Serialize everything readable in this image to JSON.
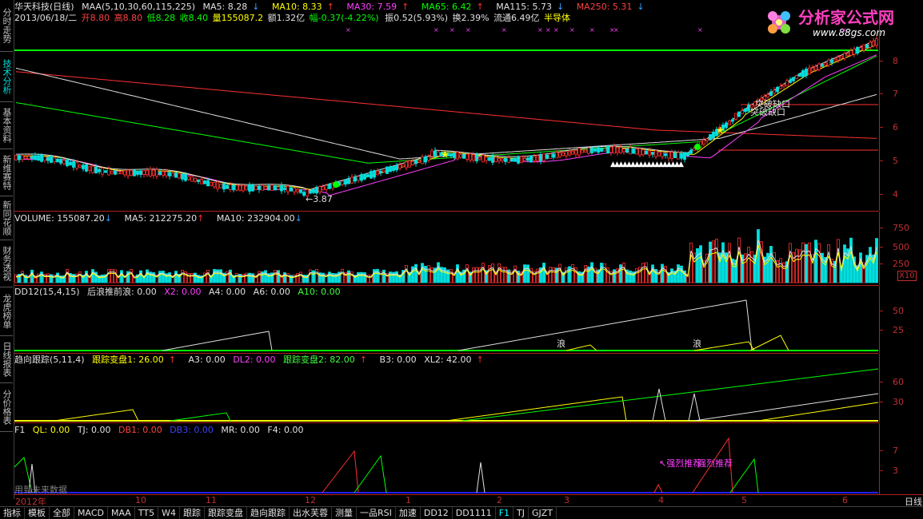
{
  "sidebar": {
    "tabs": [
      {
        "label": "分时走势",
        "active": false
      },
      {
        "label": "技术分析",
        "active": true
      },
      {
        "label": "基本资料",
        "active": false
      },
      {
        "label": "新维赛特",
        "active": false
      },
      {
        "label": "新同花顺",
        "active": false
      },
      {
        "label": "财务透视",
        "active": false
      },
      {
        "label": "龙虎榜单",
        "active": false
      },
      {
        "label": "日线报表",
        "active": false
      },
      {
        "label": "分价格表",
        "active": false
      }
    ]
  },
  "header": {
    "stock": "华天科技(日线)",
    "maa": "MAA(5,10,30,60,115,225)",
    "ma5": "MA5: 8.28",
    "ma10": "MA10: 8.33",
    "ma30": "MA30: 7.59",
    "ma65": "MA65: 6.42",
    "ma115": "MA115: 5.73",
    "ma250": "MA250: 5.31",
    "date": "2013/06/18/二",
    "open": "开8.80",
    "high": "高8.80",
    "low": "低8.28",
    "close": "收8.40",
    "volume": "量155087.2",
    "amount": "额1.32亿",
    "change": "幅-0.37(-4.22%)",
    "amplitude": "振0.52(5.93%)",
    "turnover": "换2.39%",
    "float": "流通6.49亿",
    "sector": "半导体"
  },
  "logo": {
    "title": "分析家公式网",
    "url": "www.88gs.com"
  },
  "main_chart": {
    "low_label": "←3.87",
    "gap_label_1": "突破缺口",
    "gap_label_2": "突破缺口",
    "price_ticks": [
      "8",
      "7",
      "6",
      "5",
      "4"
    ]
  },
  "volume_panel": {
    "title": "VOLUME: 155087.20",
    "ma5": "MA5: 212275.20",
    "ma10": "MA10: 232904.00",
    "ticks": [
      "750",
      "500",
      "250"
    ],
    "unit": "X10"
  },
  "dd_panel": {
    "title": "DD12(15,4,15)",
    "label1": "后浪推前浪: 0.00",
    "x2": "X2: 0.00",
    "a4": "A4: 0.00",
    "a6": "A6: 0.00",
    "a10": "A10: 0.00",
    "ticks": [
      "50",
      "25"
    ],
    "wave_label": "浪"
  },
  "trend_panel": {
    "title": "趋向跟踪(5,11,4)",
    "t1": "跟踪变盘1: 26.00",
    "a3": "A3: 0.00",
    "dl2": "DL2: 0.00",
    "t2": "跟踪变盘2: 82.00",
    "b3": "B3: 0.00",
    "xl2": "XL2: 42.00",
    "ticks": [
      "60",
      "30"
    ]
  },
  "f1_panel": {
    "title": "F1",
    "ql": "QL: 0.00",
    "tj": "TJ: 0.00",
    "db1": "DB1: 0.00",
    "db3": "DB3: 0.00",
    "mr": "MR: 0.00",
    "f4": "F4: 0.00",
    "ticks": [
      "7",
      "3"
    ],
    "recommend": "↖强烈推荐",
    "recommend2": "强烈推荐",
    "future_note": "用到未来数据"
  },
  "datebar": {
    "labels": [
      "2012年",
      "10",
      "11",
      "12",
      "1",
      "2",
      "3",
      "4",
      "5",
      "6"
    ],
    "period": "日线"
  },
  "bottom_tabs": [
    "指标",
    "模板",
    "全部",
    "MACD",
    "MAA",
    "TT5",
    "W4",
    "跟踪",
    "跟踪变盘",
    "趋向跟踪",
    "出水芙蓉",
    "测量",
    "一品RSI",
    "加速",
    "DD12",
    "DD1111",
    "F1",
    "TJ",
    "GJZT"
  ],
  "active_bottom_tab": "F1",
  "colors": {
    "up": "#ff3030",
    "down": "#00ffff",
    "axis": "#b02020",
    "ma_green": "#00ff00"
  }
}
